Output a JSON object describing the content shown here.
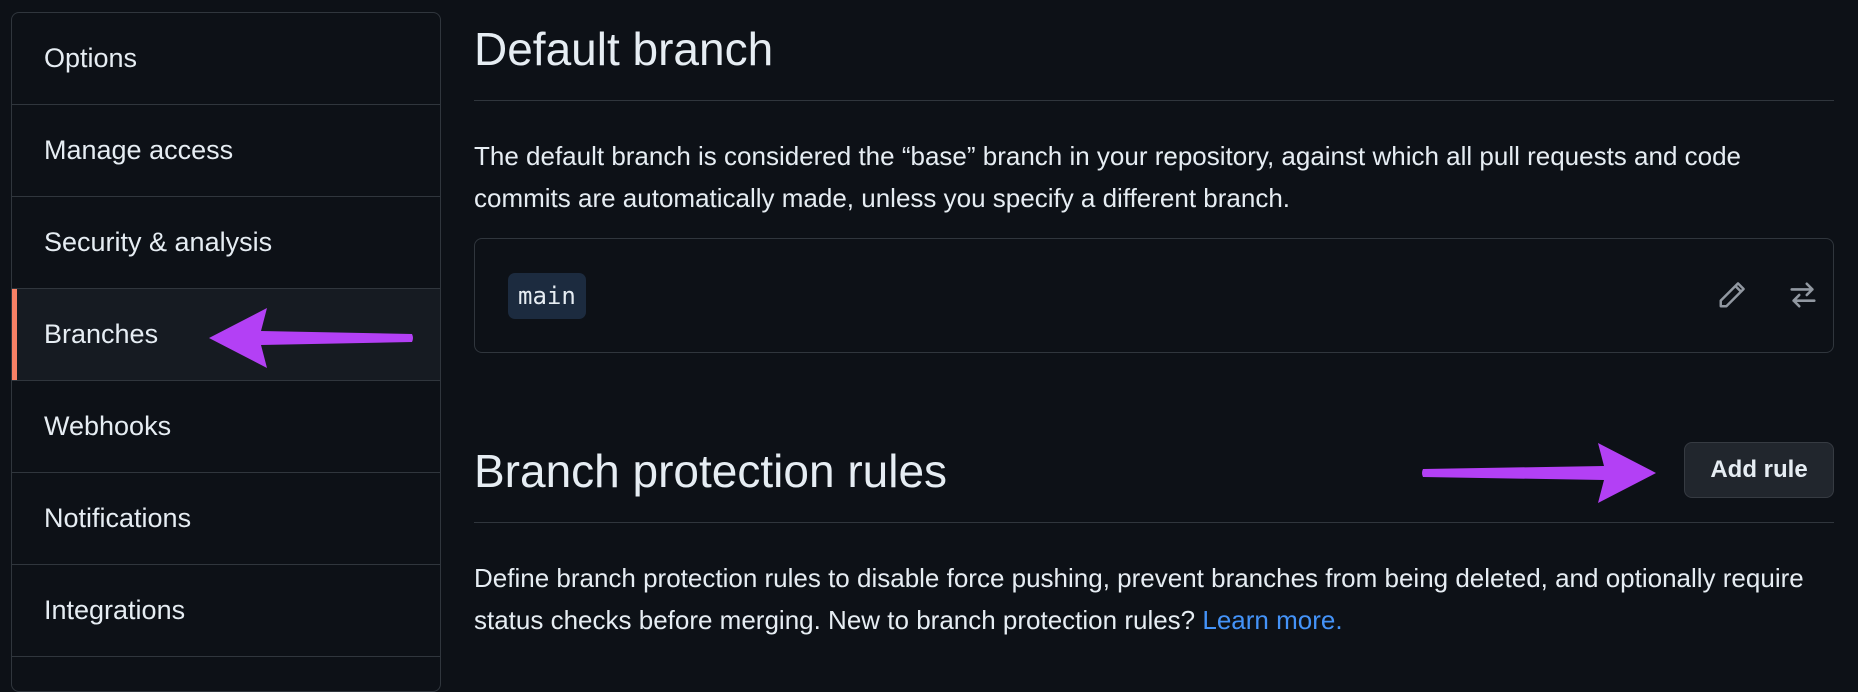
{
  "sidebar": {
    "items": [
      {
        "label": "Options"
      },
      {
        "label": "Manage access"
      },
      {
        "label": "Security & analysis"
      },
      {
        "label": "Branches",
        "selected": true
      },
      {
        "label": "Webhooks"
      },
      {
        "label": "Notifications"
      },
      {
        "label": "Integrations"
      }
    ]
  },
  "default_branch": {
    "title": "Default branch",
    "description": "The default branch is considered the “base” branch in your repository, against which all pull requests and code commits are automatically made, unless you specify a different branch.",
    "branch_name": "main",
    "edit_icon": "pencil-icon",
    "switch_icon": "arrow-switch-icon"
  },
  "protection": {
    "title": "Branch protection rules",
    "add_button": "Add rule",
    "description": "Define branch protection rules to disable force pushing, prevent branches from being deleted, and optionally require status checks before merging. New to branch protection rules?",
    "learn_more": "Learn more."
  },
  "colors": {
    "background": "#0d1117",
    "border": "#30363d",
    "selected_indicator": "#f78166",
    "link": "#4493f8",
    "annotation_arrow": "#b340f5"
  }
}
